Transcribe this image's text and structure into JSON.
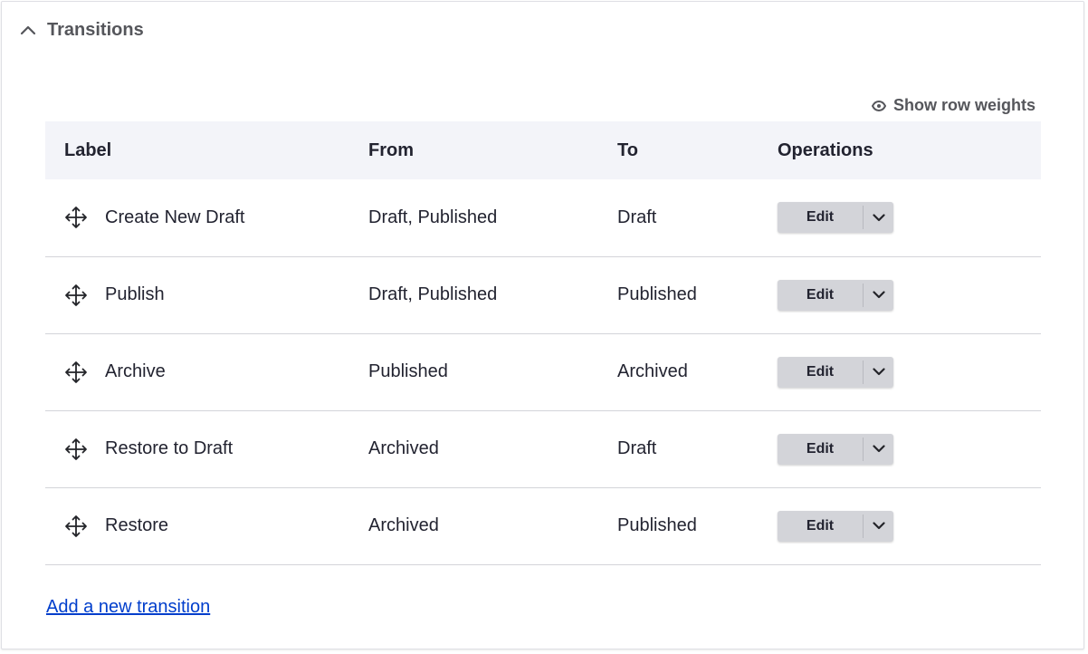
{
  "section": {
    "title": "Transitions"
  },
  "toolbar": {
    "show_row_weights": "Show row weights"
  },
  "table": {
    "headers": {
      "label": "Label",
      "from": "From",
      "to": "To",
      "operations": "Operations"
    },
    "rows": [
      {
        "label": "Create New Draft",
        "from": "Draft, Published",
        "to": "Draft",
        "edit": "Edit"
      },
      {
        "label": "Publish",
        "from": "Draft, Published",
        "to": "Published",
        "edit": "Edit"
      },
      {
        "label": "Archive",
        "from": "Published",
        "to": "Archived",
        "edit": "Edit"
      },
      {
        "label": "Restore to Draft",
        "from": "Archived",
        "to": "Draft",
        "edit": "Edit"
      },
      {
        "label": "Restore",
        "from": "Archived",
        "to": "Published",
        "edit": "Edit"
      }
    ]
  },
  "add_link": "Add a new transition",
  "colors": {
    "link": "#003ecc",
    "header_bg": "#f3f4f9",
    "button_bg": "#d3d4d9"
  },
  "icons": {
    "collapse": "chevron-up-icon",
    "weights": "eye-icon",
    "drag": "drag-handle-icon",
    "dropdown": "chevron-down-icon"
  }
}
